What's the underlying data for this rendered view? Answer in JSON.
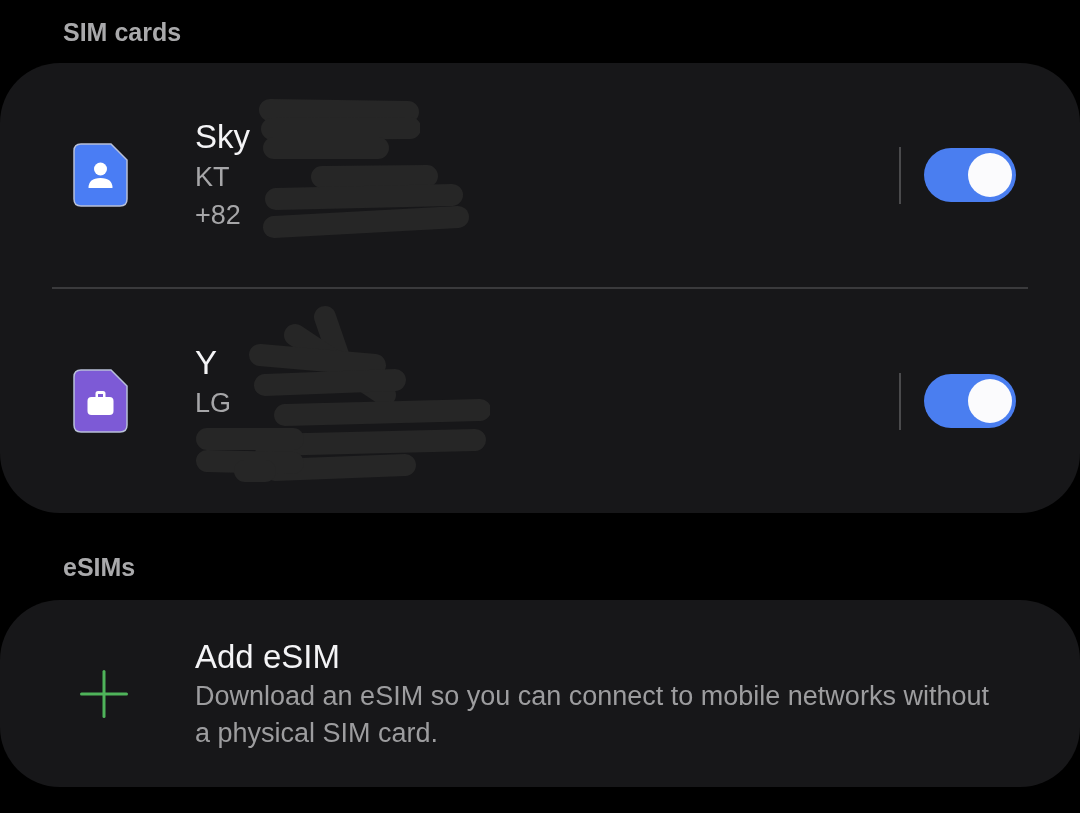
{
  "sim_cards": {
    "title": "SIM cards",
    "items": [
      {
        "name": "Sky",
        "carrier": "KT",
        "number": "+82",
        "color": "#4a7df4",
        "on": true,
        "redacted": true
      },
      {
        "name": "Y",
        "carrier": "LG",
        "color": "#7d5ad6",
        "on": true,
        "redacted": true
      }
    ]
  },
  "esims": {
    "title": "eSIMs",
    "items": [
      {
        "title": "Add eSIM",
        "description": "Download an eSIM so you can connect to mobile networks without a physical SIM card."
      }
    ]
  }
}
